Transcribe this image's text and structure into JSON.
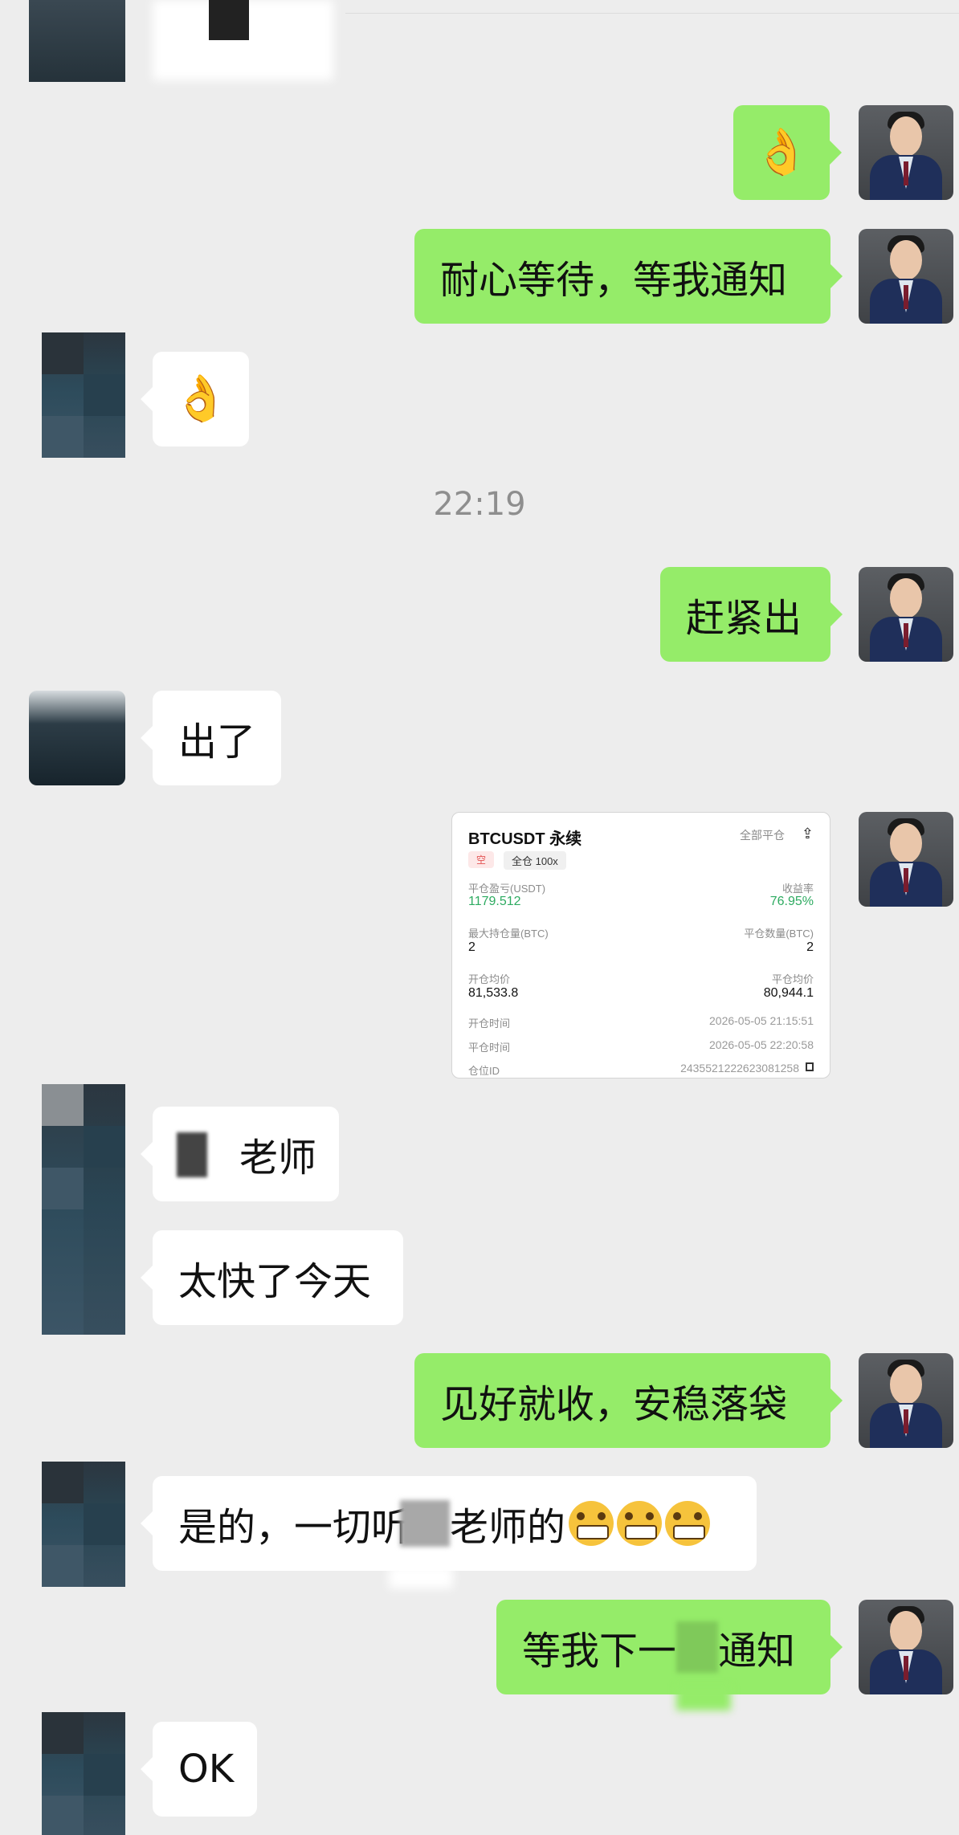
{
  "messages": [
    {
      "id": "m1",
      "side": "me",
      "text": "👌"
    },
    {
      "id": "m2",
      "side": "me",
      "text": "耐心等待，等我通知"
    },
    {
      "id": "m3",
      "side": "other",
      "text": "👌"
    },
    {
      "id": "m4",
      "side": "me",
      "text": "赶紧出"
    },
    {
      "id": "m5",
      "side": "other",
      "text": "出了"
    },
    {
      "id": "m6",
      "side": "other",
      "text": "老师"
    },
    {
      "id": "m7",
      "side": "other",
      "text": "太快了今天"
    },
    {
      "id": "m8",
      "side": "me",
      "text": "见好就收，安稳落袋"
    },
    {
      "id": "m9",
      "side": "other",
      "text_a": "是的，一切听",
      "text_b": "老师的"
    },
    {
      "id": "m10",
      "side": "me",
      "text_a": "等我下一",
      "text_b": "通知"
    },
    {
      "id": "m11",
      "side": "other",
      "text": "OK"
    }
  ],
  "timestamp": "22:19",
  "trade_card": {
    "title": "BTCUSDT 永续",
    "close_all": "全部平仓",
    "tag_direction": "空",
    "tag_margin": "全仓 100x",
    "pnl_label": "平仓盈亏(USDT)",
    "pnl_value": "1179.512",
    "roi_label": "收益率",
    "roi_value": "76.95%",
    "max_pos_label": "最大持仓量(BTC)",
    "max_pos_value": "2",
    "close_qty_label": "平仓数量(BTC)",
    "close_qty_value": "2",
    "open_avg_label": "开仓均价",
    "open_avg_value": "81,533.8",
    "close_avg_label": "平仓均价",
    "close_avg_value": "80,944.1",
    "open_time_label": "开仓时间",
    "open_time_value": "2026-05-05 21:15:51",
    "close_time_label": "平仓时间",
    "close_time_value": "2026-05-05 22:20:58",
    "position_id_label": "仓位ID",
    "position_id_value": "2435521222623081258"
  },
  "colors": {
    "bubble_me": "#95ec69",
    "bubble_other": "#ffffff",
    "background": "#ededed",
    "profit": "#2eab61"
  },
  "icons": {
    "share": "share-icon",
    "copy": "copy-icon"
  }
}
